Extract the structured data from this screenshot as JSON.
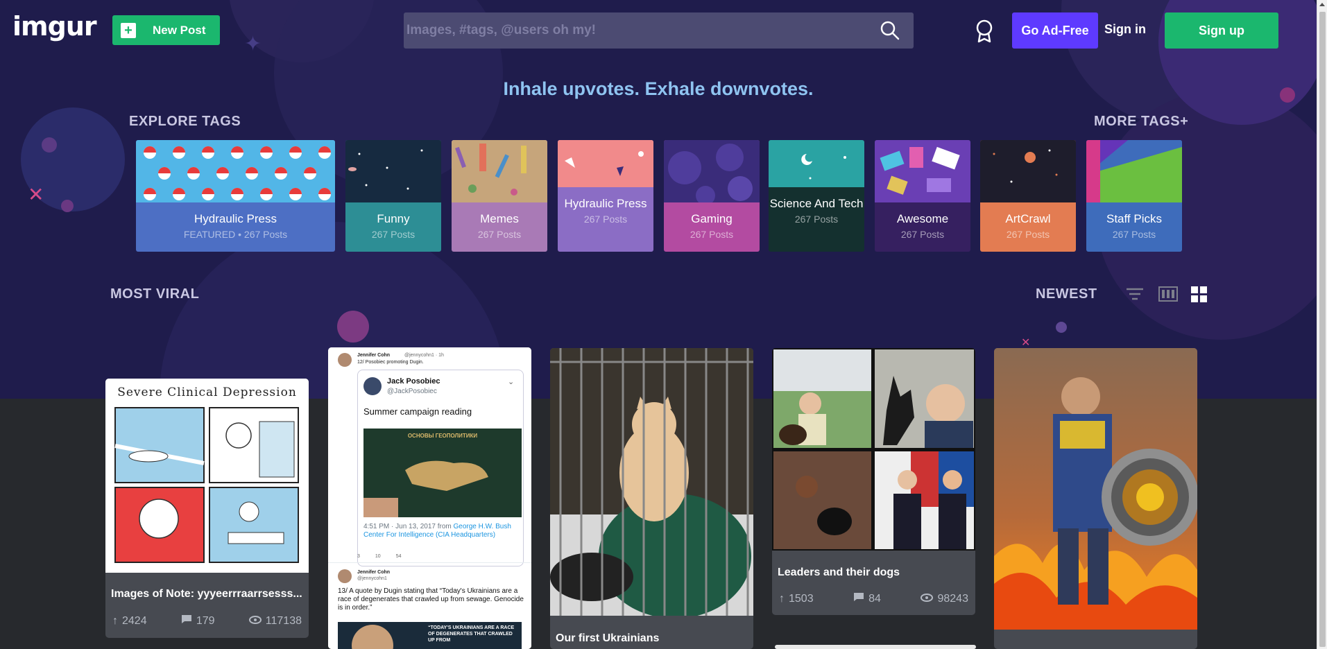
{
  "header": {
    "logo": "imgur",
    "new_post_label": "New Post",
    "search_placeholder": "Images, #tags, @users oh my!",
    "go_ad_free_label": "Go Ad-Free",
    "sign_in_label": "Sign in",
    "sign_up_label": "Sign up"
  },
  "tagline": "Inhale upvotes. Exhale downvotes.",
  "explore": {
    "heading": "EXPLORE TAGS",
    "more_label": "MORE TAGS+",
    "tags": [
      {
        "name": "Hydraulic Press",
        "count": "FEATURED • 267 Posts",
        "color": "#4d6fc4",
        "art": "#52b6e7"
      },
      {
        "name": "Funny",
        "count": "267 Posts",
        "color": "#2d8e95",
        "art": "#162a40"
      },
      {
        "name": "Memes",
        "count": "267 Posts",
        "color": "#a97ab6",
        "art": "#c6a57b"
      },
      {
        "name": "Hydraulic Press",
        "count": "267 Posts",
        "color": "#8b6dc5",
        "art": "#f18a8b"
      },
      {
        "name": "Gaming",
        "count": "267 Posts",
        "color": "#b34ba1",
        "art": "#3a2c7a"
      },
      {
        "name": "Science And Tech",
        "count": "267 Posts",
        "color": "#14302f",
        "art": "#2aa3a3"
      },
      {
        "name": "Awesome",
        "count": "267 Posts",
        "color": "#362060",
        "art": "#6a3fb4"
      },
      {
        "name": "ArtCrawl",
        "count": "267 Posts",
        "color": "#e37c52",
        "art": "#1e1d2c"
      },
      {
        "name": "Staff Picks",
        "count": "267 Posts",
        "color": "#3e6cbb",
        "art": "#6bbf40"
      }
    ]
  },
  "feed": {
    "heading": "MOST VIRAL",
    "sort_label": "NEWEST"
  },
  "posts": [
    {
      "title": "Images of Note: yyyeerrraarrsesss...",
      "upvotes": "2424",
      "comments": "179",
      "views": "117138",
      "comic_title": "Severe Clinical Depression"
    },
    {
      "title": "",
      "upvotes": "",
      "comments": "",
      "views": "",
      "tweet": {
        "author": "Jennifer Cohn",
        "handle": "@jennycohn1 · 1h",
        "line1": "12/ Posobiec promoting Dugin.",
        "quoted_name": "Jack Posobiec",
        "quoted_handle": "@JackPosobiec",
        "quoted_text": "Summer campaign reading",
        "book_title": "ОСНОВЫ ГЕОПОЛИТИКИ",
        "timestamp": "4:51 PM · Jun 13, 2017 from",
        "location": "George H.W. Bush Center For Intelligence (CIA Headquarters)",
        "replies": "3",
        "retweets": "10",
        "likes": "54",
        "second_author": "Jennifer Cohn",
        "second_handle": "@jennycohn1",
        "second_text": "13/ A quote by Dugin stating that “Today's Ukrainians are a race of degenerates that crawled up from sewage. Genocide is in order.”",
        "overlay_text": "“TODAY'S UKRAINIANS ARE A RACE OF DEGENERATES THAT CRAWLED UP FROM"
      }
    },
    {
      "title": "Our first Ukrainians",
      "upvotes": "",
      "comments": "",
      "views": ""
    },
    {
      "title": "Leaders and their dogs",
      "upvotes": "1503",
      "comments": "84",
      "views": "98243"
    },
    {
      "title": "",
      "upvotes": "",
      "comments": "",
      "views": ""
    }
  ],
  "colors": {
    "hero_bg": "#1f1c4c",
    "page_bg": "#27292d",
    "green": "#1bb76e",
    "purple": "#5e3aff",
    "tagline": "#8fc4f1",
    "card_bg": "#474a51"
  }
}
